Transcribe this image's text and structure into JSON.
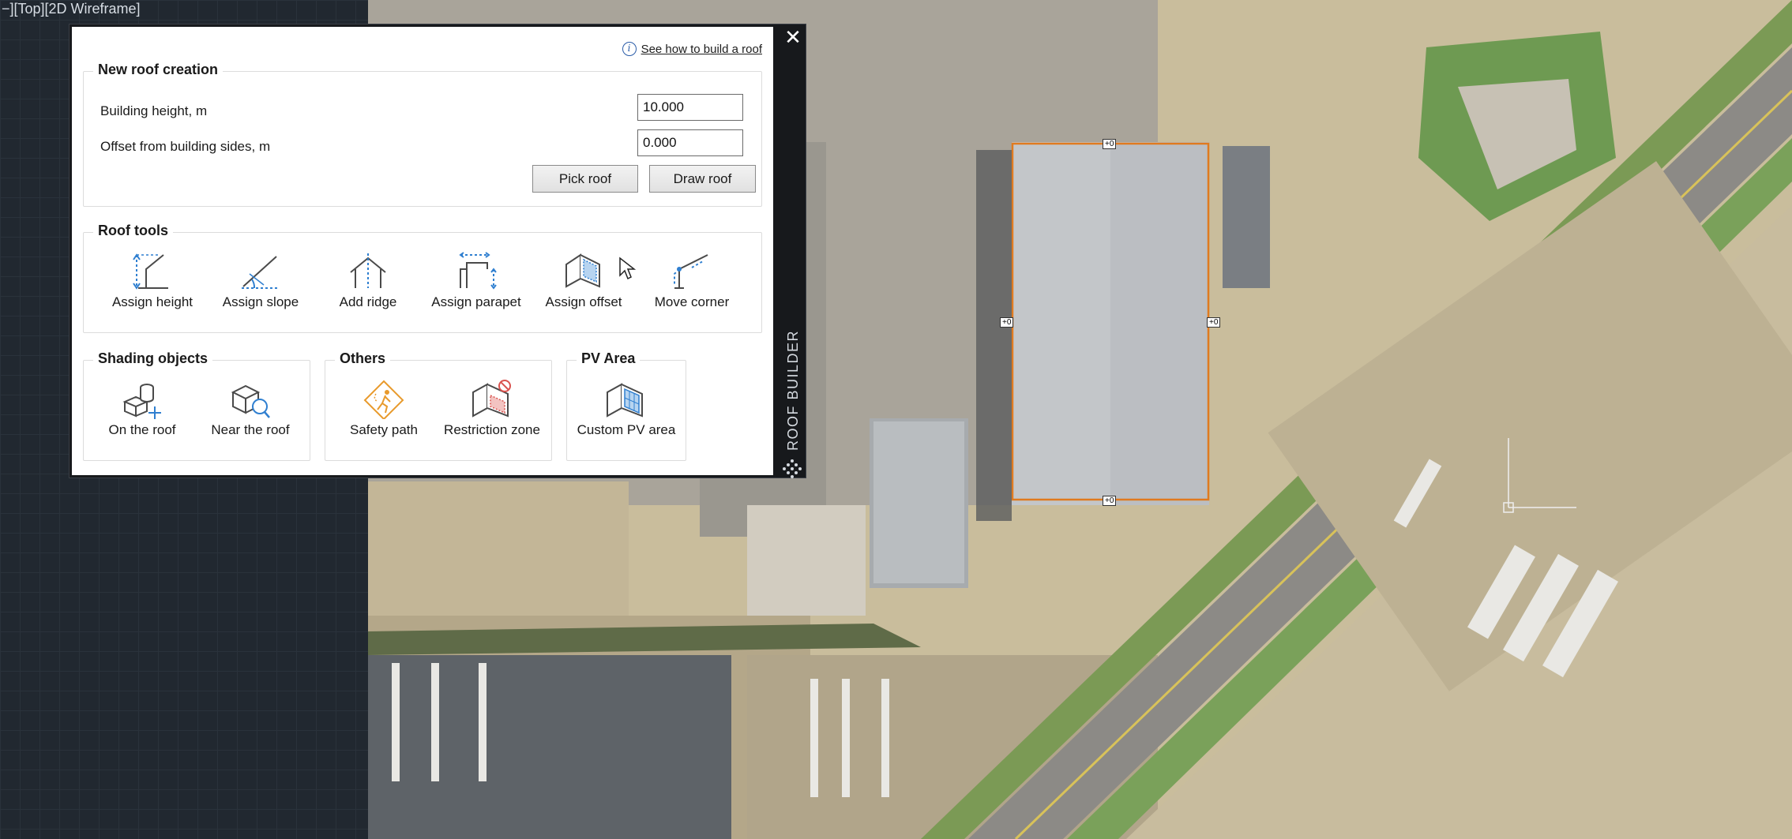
{
  "viewport": {
    "label": "−][Top][2D Wireframe]"
  },
  "panel": {
    "side_title": "ROOF BUILDER",
    "help_link": "See how to build a roof",
    "new_roof": {
      "title": "New roof creation",
      "height_label": "Building height, m",
      "height_value": "10.000",
      "offset_label": "Offset from building sides, m",
      "offset_value": "0.000",
      "pick_label": "Pick roof",
      "draw_label": "Draw roof"
    },
    "roof_tools": {
      "title": "Roof tools",
      "items": [
        {
          "label": "Assign height",
          "icon": "assign-height-icon"
        },
        {
          "label": "Assign slope",
          "icon": "assign-slope-icon"
        },
        {
          "label": "Add ridge",
          "icon": "add-ridge-icon"
        },
        {
          "label": "Assign parapet",
          "icon": "assign-parapet-icon"
        },
        {
          "label": "Assign offset",
          "icon": "assign-offset-icon"
        },
        {
          "label": "Move corner",
          "icon": "move-corner-icon"
        }
      ]
    },
    "shading": {
      "title": "Shading objects",
      "items": [
        {
          "label": "On the roof",
          "icon": "on-roof-icon"
        },
        {
          "label": "Near the roof",
          "icon": "near-roof-icon"
        }
      ]
    },
    "others": {
      "title": "Others",
      "items": [
        {
          "label": "Safety path",
          "icon": "safety-path-icon"
        },
        {
          "label": "Restriction zone",
          "icon": "restriction-zone-icon"
        }
      ]
    },
    "pv_area": {
      "title": "PV Area",
      "items": [
        {
          "label": "Custom PV area",
          "icon": "custom-pv-area-icon"
        }
      ]
    }
  },
  "map": {
    "roof_markers": [
      "+0",
      "+0",
      "+0",
      "+0"
    ]
  },
  "colors": {
    "accent_orange": "#e07a1f",
    "icon_blue": "#2f7fd0",
    "icon_gray": "#4a4a4a",
    "warning_orange": "#e89a2c",
    "restriction_red": "#d9534f"
  }
}
